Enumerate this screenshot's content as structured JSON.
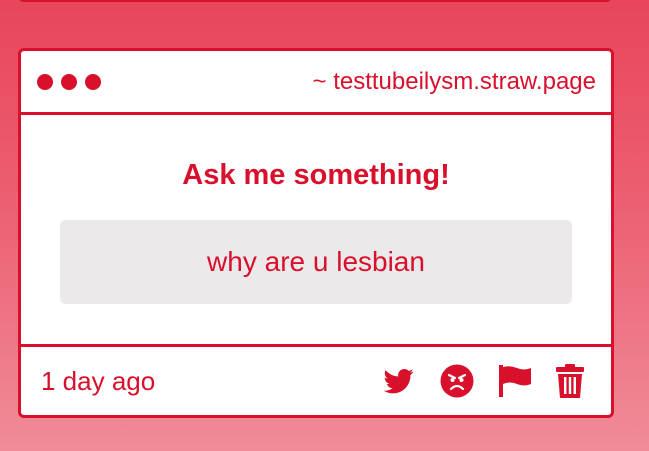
{
  "card": {
    "site": "~ testtubeilysm.straw.page",
    "heading": "Ask me something!",
    "question": "why are u lesbian",
    "time": "1 day ago"
  },
  "icons": [
    "twitter-icon",
    "angry-face-icon",
    "flag-icon",
    "trash-icon"
  ],
  "colors": {
    "accent": "#d9102c",
    "question_bg": "#ebe9ea",
    "background_top": "#e8455a",
    "background_bottom": "#f08c98"
  }
}
